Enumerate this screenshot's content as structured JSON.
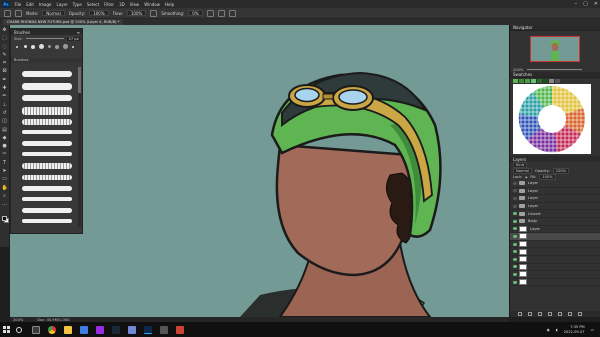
{
  "menubar": {
    "logo": "Ps",
    "items": [
      "File",
      "Edit",
      "Image",
      "Layer",
      "Type",
      "Select",
      "Filter",
      "3D",
      "View",
      "Window",
      "Help"
    ]
  },
  "options": {
    "mode_label": "Mode:",
    "mode_value": "Normal",
    "opacity_label": "Opacity:",
    "opacity_value": "100%",
    "flow_label": "Flow:",
    "flow_value": "100%",
    "smoothing_label": "Smoothing:",
    "smoothing_value": "0%"
  },
  "document": {
    "tab_title": "CHARB RHONDA NEW FUTURE.psd @ 200% (Layer 4, RGB/8) *"
  },
  "brushes_panel": {
    "title": "Brushes",
    "size_label": "Size:",
    "size_value": "27 px",
    "folder_label": "Brushes"
  },
  "right_panels": {
    "navigator_title": "Navigator",
    "zoom_value": "200%",
    "swatches_title": "Swatches",
    "layers_tab": "Layers",
    "kind_label": "Kind",
    "blend_mode": "Normal",
    "opacity_label": "Opacity:",
    "opacity_value": "100%",
    "lock_label": "Lock:",
    "fill_label": "Fill:",
    "fill_value": "100%",
    "layers": [
      {
        "name": "Layer",
        "type": "folder",
        "visible": false,
        "selected": false
      },
      {
        "name": "Layer",
        "type": "folder",
        "visible": false,
        "selected": false
      },
      {
        "name": "Layer",
        "type": "folder",
        "visible": false,
        "selected": false
      },
      {
        "name": "Layer",
        "type": "folder",
        "visible": false,
        "selected": false
      },
      {
        "name": "Lineart",
        "type": "folder",
        "visible": true,
        "selected": false
      },
      {
        "name": "Body",
        "type": "folder",
        "visible": true,
        "selected": false
      },
      {
        "name": "Layer",
        "type": "layer",
        "visible": true,
        "selected": false
      },
      {
        "name": "",
        "type": "layer",
        "visible": true,
        "selected": true
      },
      {
        "name": "",
        "type": "layer",
        "visible": true,
        "selected": false
      },
      {
        "name": "",
        "type": "layer",
        "visible": true,
        "selected": false
      },
      {
        "name": "",
        "type": "layer",
        "visible": true,
        "selected": false
      },
      {
        "name": "",
        "type": "layer",
        "visible": true,
        "selected": false
      },
      {
        "name": "",
        "type": "layer",
        "visible": true,
        "selected": false
      },
      {
        "name": "",
        "type": "layer",
        "visible": true,
        "selected": false
      }
    ]
  },
  "status": {
    "zoom": "200%",
    "doc_info": "Doc: 45.9M/1.06G"
  },
  "taskbar": {
    "time": "7:35 PM",
    "date": "2022-09-07"
  },
  "colors": {
    "canvas_bg": "#749a95",
    "skin": "#a0695a",
    "hat_green": "#5fb552",
    "hat_dark": "#2f3a3a",
    "goggle_gold": "#caa645",
    "goggle_lens": "#a9d4ef"
  }
}
